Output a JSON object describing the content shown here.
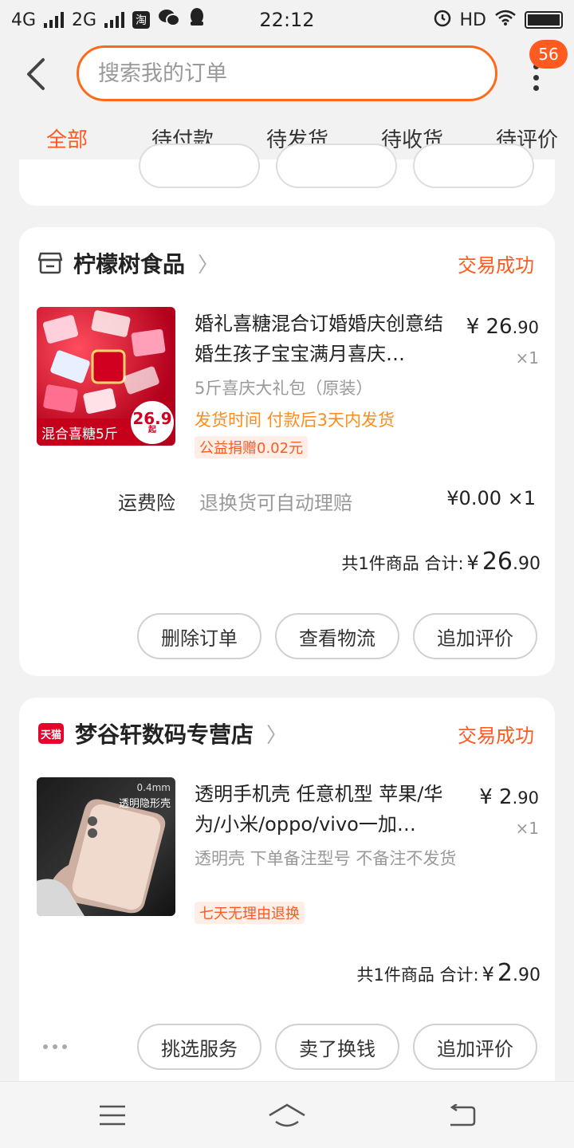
{
  "status_bar": {
    "network1": "4G",
    "network2": "2G",
    "time": "22:12",
    "hd": "HD"
  },
  "header": {
    "search_placeholder": "搜索我的订单",
    "badge_count": "56"
  },
  "tabs": [
    {
      "label": "全部",
      "active": true
    },
    {
      "label": "待付款"
    },
    {
      "label": "待发货"
    },
    {
      "label": "待收货"
    },
    {
      "label": "待评价"
    }
  ],
  "orders": [
    {
      "shop_name": "柠檬树食品",
      "status": "交易成功",
      "item": {
        "title": "婚礼喜糖混合订婚婚庆创意结婚生孩子宝宝满月喜庆…",
        "price_prefix": "¥",
        "price_main": "26",
        "price_dec": ".90",
        "qty": "×1",
        "sku": "5斤喜庆大礼包（原装）",
        "ship_time": "发货时间 付款后3天内发货",
        "tag": "公益捐赠0.02元",
        "thumb_caption": "混合喜糖5斤",
        "thumb_price": "26.9",
        "thumb_price_suffix": "起"
      },
      "insurance": {
        "label": "运费险",
        "desc": "退换货可自动理赔",
        "price": "¥0.00 ×1"
      },
      "summary": {
        "count_text": "共1件商品 合计:",
        "price_prefix": "¥",
        "price_main": "26",
        "price_dec": ".90"
      },
      "actions": [
        "删除订单",
        "查看物流",
        "追加评价"
      ]
    },
    {
      "shop_name": "梦谷轩数码专营店",
      "status": "交易成功",
      "shop_badge": "天猫",
      "item": {
        "title": "透明手机壳 任意机型 苹果/华为/小米/oppo/vivo一加…",
        "price_prefix": "¥",
        "price_main": "2",
        "price_dec": ".90",
        "qty": "×1",
        "sku": "透明壳 下单备注型号 不备注不发货",
        "tag": "七天无理由退换",
        "thumb_caption": "透明隐形壳",
        "thumb_spec": "0.4mm"
      },
      "summary": {
        "count_text": "共1件商品 合计:",
        "price_prefix": "¥",
        "price_main": "2",
        "price_dec": ".90"
      },
      "actions": [
        "挑选服务",
        "卖了换钱",
        "追加评价"
      ]
    }
  ],
  "colors": {
    "accent": "#ff5a1f",
    "ship_time": "#ff8c1a",
    "background": "#f2f2f2"
  }
}
